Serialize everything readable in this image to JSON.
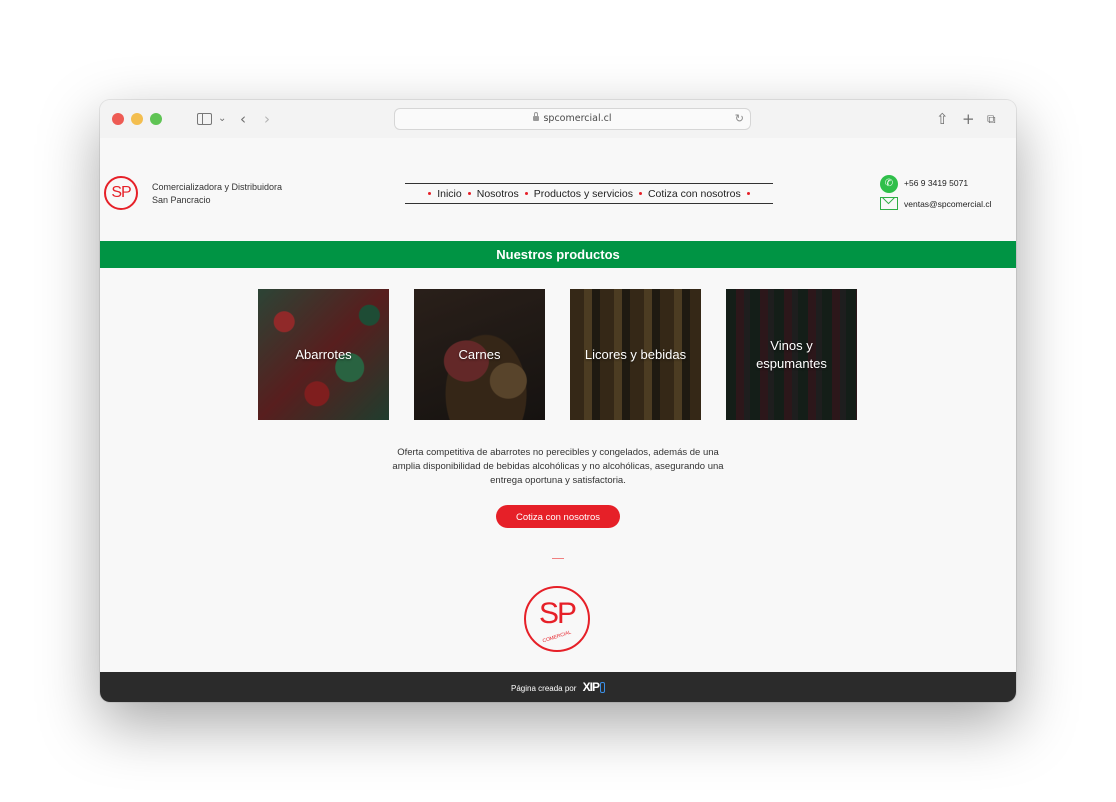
{
  "browser": {
    "url": "spcomercial.cl"
  },
  "header": {
    "logo_text": "SP",
    "brand_line1": "Comercializadora y Distribuidora",
    "brand_line2": "San Pancracio",
    "nav": [
      "Inicio",
      "Nosotros",
      "Productos y servicios",
      "Cotiza con nosotros"
    ],
    "phone": "+56 9 3419 5071",
    "email": "ventas@spcomercial.cl"
  },
  "banner": {
    "title": "Nuestros productos"
  },
  "products": [
    {
      "label": "Abarrotes"
    },
    {
      "label": "Carnes"
    },
    {
      "label": "Licores y bebidas"
    },
    {
      "label": "Vinos y espumantes"
    }
  ],
  "description": "Oferta competitiva de abarrotes no perecibles y congelados, además de una amplia disponibilidad de bebidas alcohólicas y no alcohólicas, asegurando una entrega oportuna y satisfactoria.",
  "cta_label": "Cotiza con nosotros",
  "footer_logo": {
    "letters": "SP",
    "sub": "COMERCIAL"
  },
  "footer": {
    "text": "Página creada por",
    "maker_logo": "XIP"
  },
  "colors": {
    "brand_red": "#e62028",
    "banner_green": "#009444",
    "footer_dark": "#2b2b2b"
  }
}
